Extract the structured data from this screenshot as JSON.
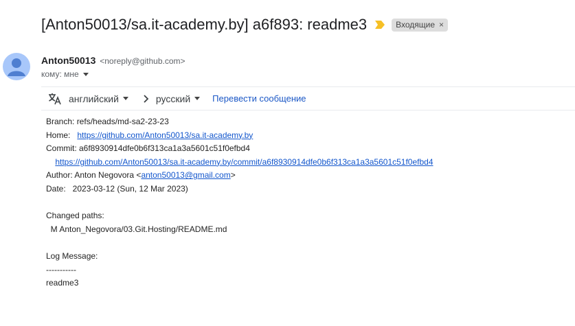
{
  "subject": "[Anton50013/sa.it-academy.by] a6f893: readme3",
  "label": "Входящие",
  "label_close": "×",
  "sender": {
    "name": "Anton50013",
    "email": "<noreply@github.com>",
    "to": "кому: мне"
  },
  "translate": {
    "from_lang": "английский",
    "to_lang": "русский",
    "action": "Перевести сообщение"
  },
  "body": {
    "branch": "Branch: refs/heads/md-sa2-23-23",
    "home_label": "Home:   ",
    "home_url": "https://github.com/Anton50013/sa.it-academy.by",
    "commit": "Commit: a6f8930914dfe0b6f313ca1a3a5601c51f0efbd4",
    "commit_url": "https://github.com/Anton50013/sa.it-academy.by/commit/a6f8930914dfe0b6f313ca1a3a5601c51f0efbd4",
    "author_prefix": "Author: Anton Negovora <",
    "author_email": "anton50013@gmail.com",
    "author_suffix": ">",
    "date": "Date:   2023-03-12 (Sun, 12 Mar 2023)",
    "changed_paths": "Changed paths:",
    "changed_file": "  M Anton_Negovora/03.Git.Hosting/README.md",
    "log_message": "Log Message:",
    "separator": "-----------",
    "message": "readme3"
  }
}
